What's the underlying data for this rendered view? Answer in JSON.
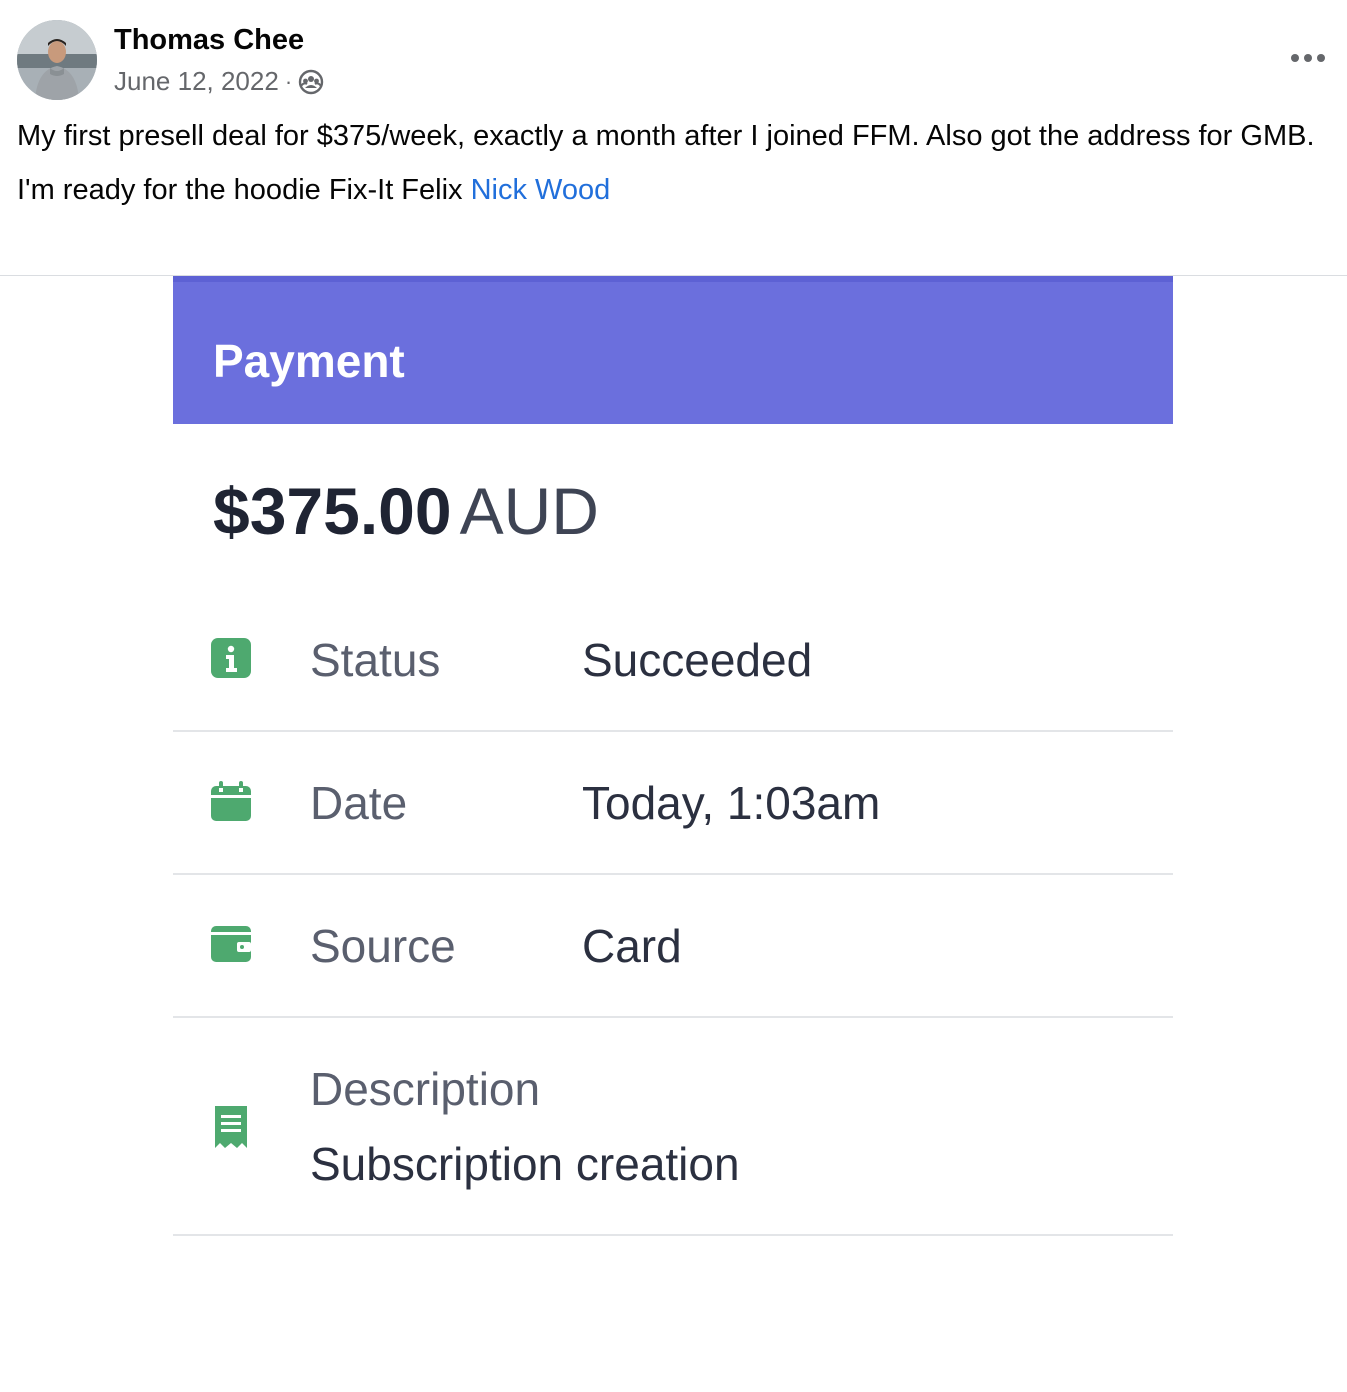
{
  "post": {
    "author": "Thomas Chee",
    "date": "June 12, 2022",
    "separator": "·",
    "paragraph1": "My first presell deal for $375/week, exactly a month after I joined FFM. Also got the address for GMB.",
    "paragraph2_prefix": "I'm ready for the hoodie Fix-It Felix ",
    "mention": "Nick Wood",
    "more_icon": "more-horizontal-icon",
    "privacy_icon": "group-privacy-icon"
  },
  "payment": {
    "title": "Payment",
    "amount": "$375.00",
    "currency": "AUD",
    "header_color": "#6b6fdd",
    "icon_color": "#4ea96f",
    "rows": [
      {
        "label": "Status",
        "value": "Succeeded",
        "icon": "info-icon"
      },
      {
        "label": "Date",
        "value": "Today, 1:03am",
        "icon": "calendar-icon"
      },
      {
        "label": "Source",
        "value": "Card",
        "icon": "wallet-icon"
      },
      {
        "label": "Description",
        "value": "Subscription creation",
        "icon": "receipt-icon"
      }
    ]
  }
}
